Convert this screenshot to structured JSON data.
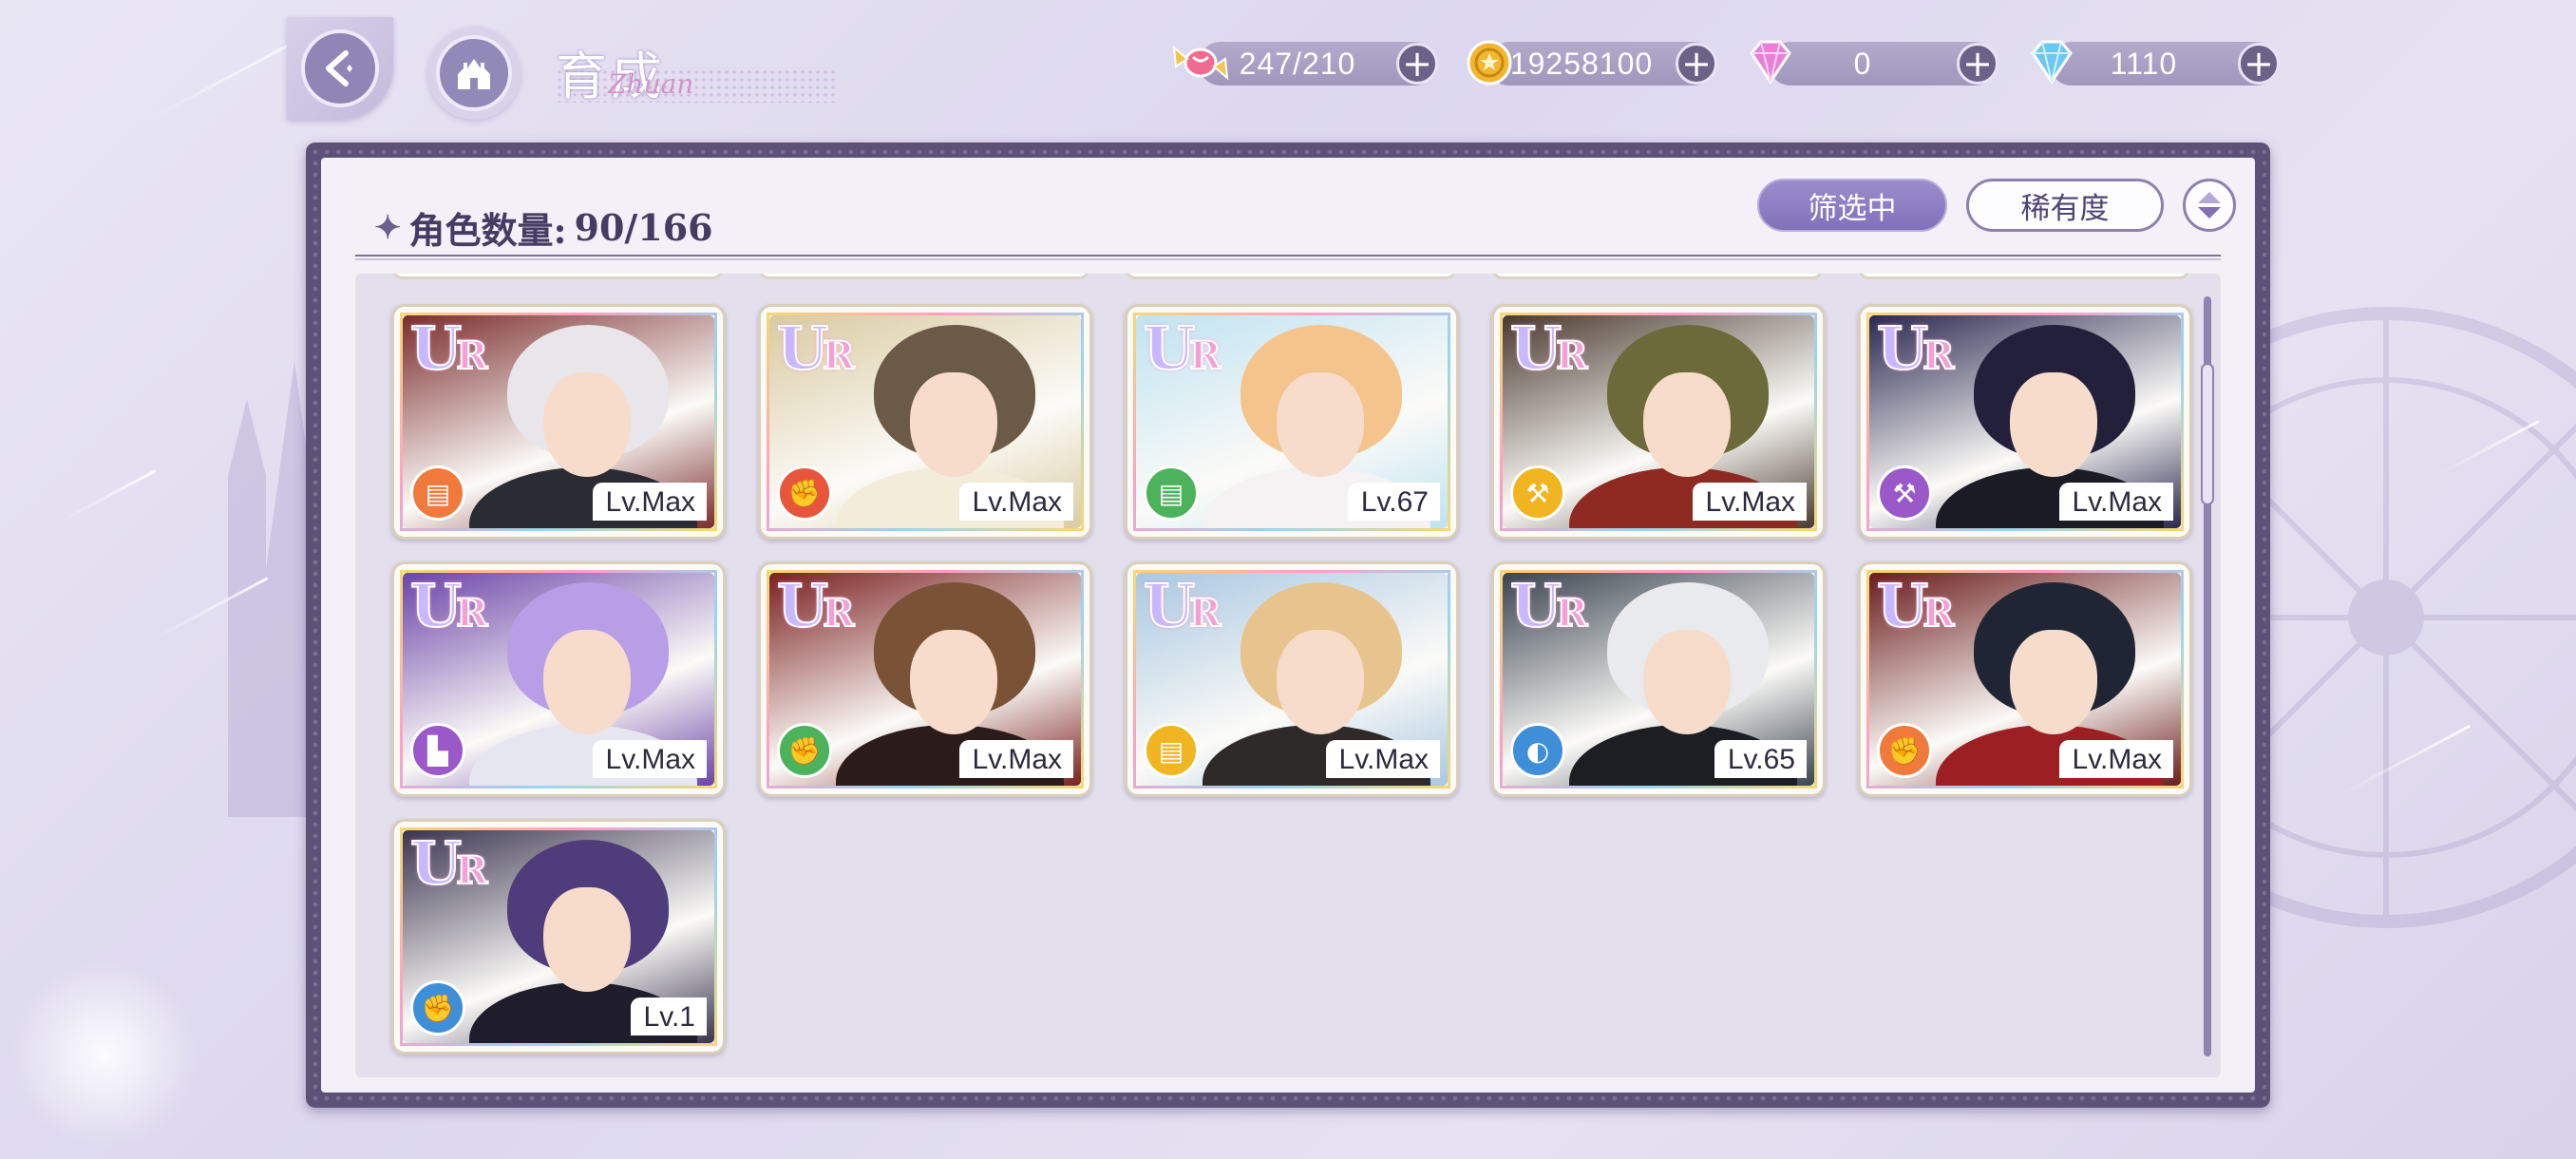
{
  "header": {
    "title": "育成",
    "title_script": "Zhuan",
    "back_icon": "back-arrow-icon",
    "home_icon": "castle-icon"
  },
  "resources": [
    {
      "name": "candy",
      "icon": "candy-icon",
      "value": "247/210",
      "color": "#e85a8a"
    },
    {
      "name": "gold",
      "icon": "coin-icon",
      "value": "19258100",
      "color": "#f2b632"
    },
    {
      "name": "pink-diamond",
      "icon": "pink-diamond-icon",
      "value": "0",
      "color": "#e884d8"
    },
    {
      "name": "blue-diamond",
      "icon": "blue-diamond-icon",
      "value": "1110",
      "color": "#6cc8f0"
    }
  ],
  "panel": {
    "count_label": "角色数量:",
    "count_value": "90/166",
    "filter_label": "筛选中",
    "rarity_label": "稀有度"
  },
  "cards": [
    {
      "rarity": "UR",
      "level": "Lv.Max",
      "element": "orange",
      "element_color": "#f07a3c",
      "element_icon": "book-icon",
      "bg": "#7a2c2c",
      "hair": "#e8e6ea",
      "outfit": "#2b2b33"
    },
    {
      "rarity": "UR",
      "level": "Lv.Max",
      "element": "red",
      "element_color": "#e7563c",
      "element_icon": "fist-icon",
      "bg": "#d9cba2",
      "hair": "#6b5a48",
      "outfit": "#f2ecd9"
    },
    {
      "rarity": "UR",
      "level": "Lv.67",
      "element": "green",
      "element_color": "#4cb35c",
      "element_icon": "book-icon",
      "bg": "#bfe3f2",
      "hair": "#f5c48c",
      "outfit": "#f4f2f2"
    },
    {
      "rarity": "UR",
      "level": "Lv.Max",
      "element": "yellow",
      "element_color": "#f0b520",
      "element_icon": "hammer-icon",
      "bg": "#4a3a30",
      "hair": "#6c6a3a",
      "outfit": "#8e2a22"
    },
    {
      "rarity": "UR",
      "level": "Lv.Max",
      "element": "purple",
      "element_color": "#9a58c8",
      "element_icon": "hammer-icon",
      "bg": "#2a2850",
      "hair": "#22203a",
      "outfit": "#1b1b26"
    },
    {
      "rarity": "UR",
      "level": "Lv.Max",
      "element": "purple",
      "element_color": "#9a58c8",
      "element_icon": "boot-icon",
      "bg": "#6b44a8",
      "hair": "#b89ee6",
      "outfit": "#e6e6f0"
    },
    {
      "rarity": "UR",
      "level": "Lv.Max",
      "element": "green",
      "element_color": "#4cb35c",
      "element_icon": "fist-icon",
      "bg": "#7a2020",
      "hair": "#7a5236",
      "outfit": "#2b1b1b"
    },
    {
      "rarity": "UR",
      "level": "Lv.Max",
      "element": "yellow",
      "element_color": "#f0b520",
      "element_icon": "book-icon",
      "bg": "#a9c8e2",
      "hair": "#e7c48e",
      "outfit": "#2f2a2a"
    },
    {
      "rarity": "UR",
      "level": "Lv.65",
      "element": "blue",
      "element_color": "#3f8ed8",
      "element_icon": "shield-icon",
      "bg": "#3a4450",
      "hair": "#e9eaee",
      "outfit": "#1c1e24"
    },
    {
      "rarity": "UR",
      "level": "Lv.Max",
      "element": "orange",
      "element_color": "#f07a3c",
      "element_icon": "fist-icon",
      "bg": "#6a1c1c",
      "hair": "#202535",
      "outfit": "#9c1f24"
    },
    {
      "rarity": "UR",
      "level": "Lv.1",
      "element": "blue",
      "element_color": "#3f8ed8",
      "element_icon": "fist-icon",
      "bg": "#3a3550",
      "hair": "#4e3d7a",
      "outfit": "#1f1d2c"
    }
  ]
}
